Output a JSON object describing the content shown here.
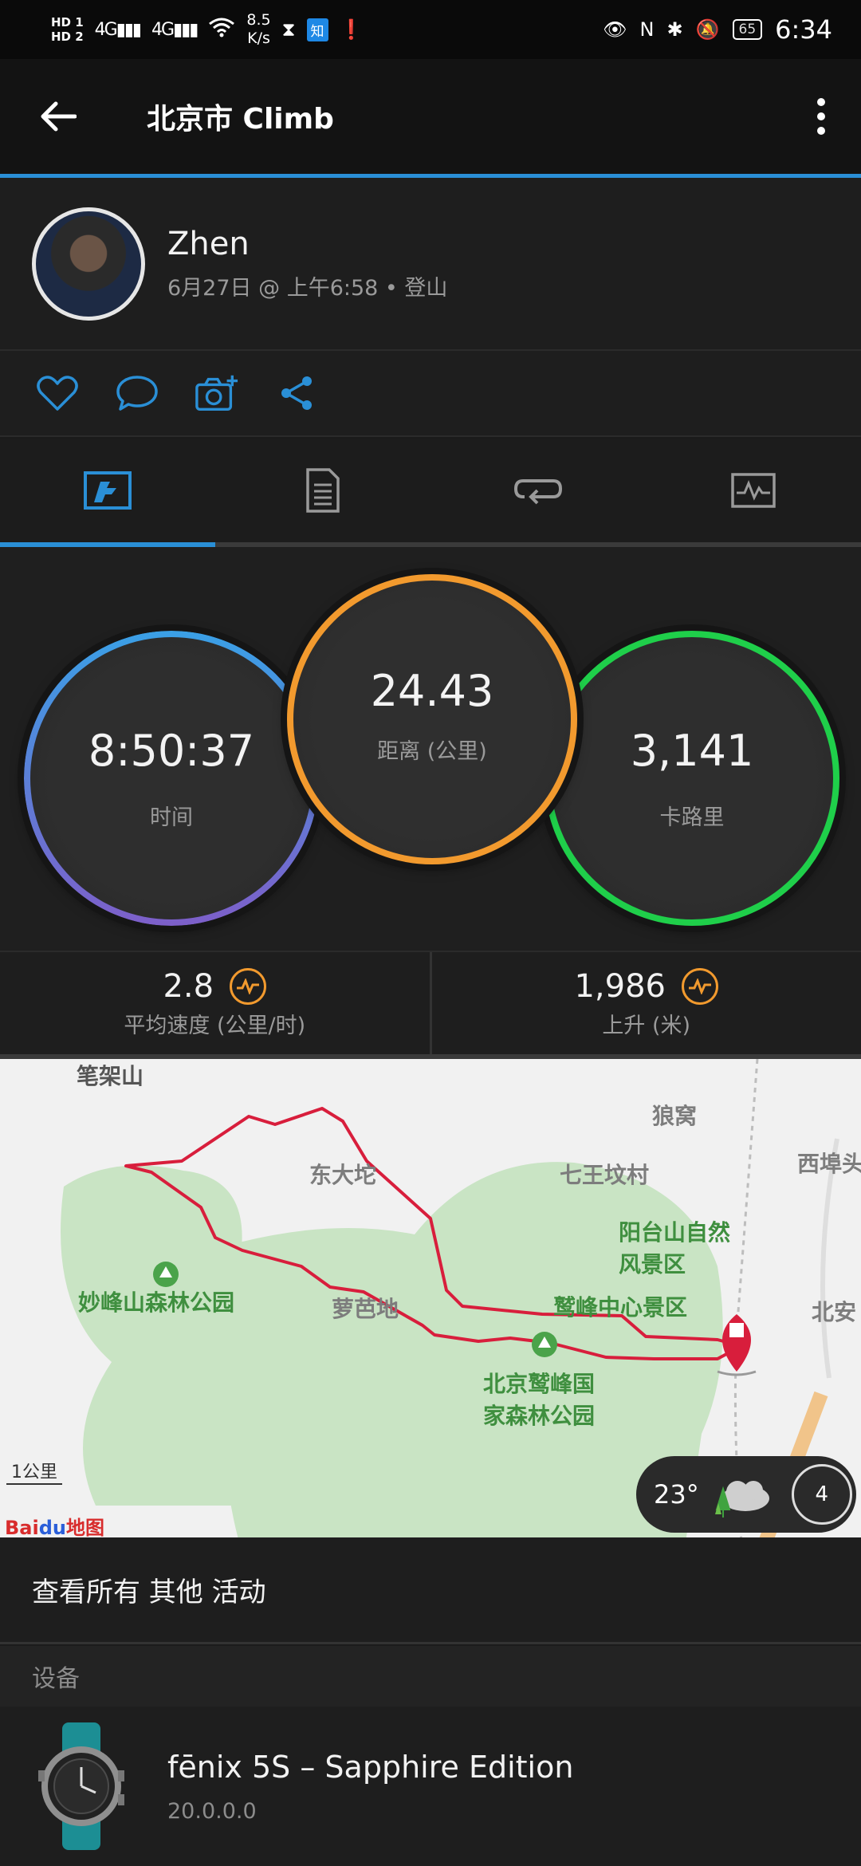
{
  "status": {
    "hd1": "HD 1",
    "hd2": "HD 2",
    "net1": "4G",
    "net2": "4G",
    "speed_value": "8.5",
    "speed_unit": "K/s",
    "app_badge": "知",
    "battery": "65",
    "time": "6:34"
  },
  "appbar": {
    "title": "北京市 Climb"
  },
  "profile": {
    "name": "Zhen",
    "meta": "6月27日 @ 上午6:58 • 登山"
  },
  "metrics": {
    "time_value": "8:50:37",
    "time_label": "时间",
    "distance_value": "24.43",
    "distance_label": "距离 (公里)",
    "calories_value": "3,141",
    "calories_label": "卡路里"
  },
  "stats": {
    "avg_speed_value": "2.8",
    "avg_speed_label": "平均速度 (公里/时)",
    "ascent_value": "1,986",
    "ascent_label": "上升 (米)"
  },
  "map": {
    "labels": {
      "l1": "笔架山",
      "l2": "狼窝",
      "l3": "东大坨",
      "l4": "七王坟村",
      "l5": "西埠头",
      "l6": "阳台山自然",
      "l7": "风景区",
      "l8": "妙峰山森林公园",
      "l9": "萝芭地",
      "l10": "鹫峰中心景区",
      "l11": "北安",
      "l12": "北京鹫峰国",
      "l13": "家森林公园"
    },
    "scale": "1公里",
    "logo_bai": "Bai",
    "logo_du": "du",
    "logo_map": "地图",
    "temperature": "23°",
    "uv_index": "4"
  },
  "viewall": "查看所有 其他 活动",
  "device_section": "设备",
  "device": {
    "name": "fēnix 5S – Sapphire Edition",
    "version": "20.0.0.0"
  },
  "colors": {
    "accent": "#2a8fd6",
    "distance_ring": "#f29a2e",
    "calories_ring": "#1fcf4a",
    "time_ring_top": "#3aa0e6",
    "time_ring_bottom": "#7d5fc9",
    "route": "#d81e3c"
  }
}
